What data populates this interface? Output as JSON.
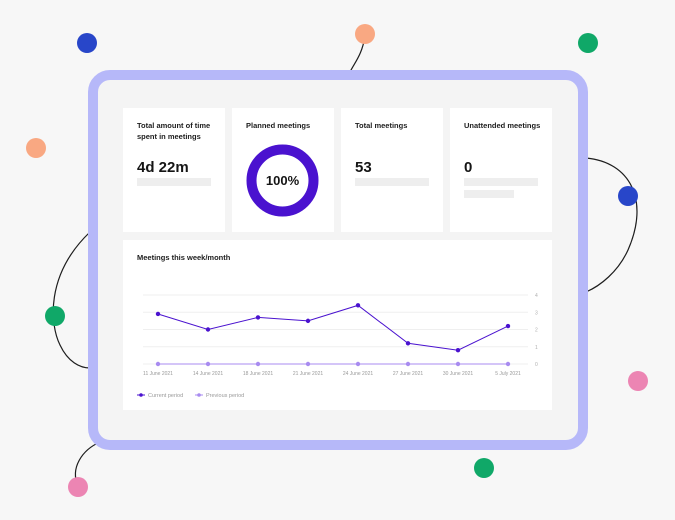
{
  "cards": {
    "total_time": {
      "title": "Total amount of time spent in meetings",
      "value": "4d 22m"
    },
    "planned": {
      "title": "Planned meetings",
      "percent_label": "100%",
      "percent": 100
    },
    "total_meetings": {
      "title": "Total meetings",
      "value": "53"
    },
    "unattended": {
      "title": "Unattended meetings",
      "value": "0"
    }
  },
  "chart": {
    "title": "Meetings this week/month"
  },
  "chart_data": {
    "type": "line",
    "categories": [
      "11 June 2021",
      "14 June 2021",
      "18 June 2021",
      "21 June 2021",
      "24 June 2021",
      "27 June 2021",
      "30 June 2021",
      "5 July 2021"
    ],
    "ylim": [
      0,
      4
    ],
    "yticks": [
      0,
      1,
      2,
      3,
      4
    ],
    "grid": true,
    "legend": "bottom-left",
    "series": [
      {
        "name": "Current period",
        "color": "#4a12cf",
        "values": [
          2.9,
          2.0,
          2.7,
          2.5,
          3.4,
          1.2,
          0.8,
          2.2
        ]
      },
      {
        "name": "Previous period",
        "color": "#a88bf0",
        "values": [
          0,
          0,
          0,
          0,
          0,
          0,
          0,
          0
        ]
      }
    ]
  },
  "colors": {
    "frame": "#b6b8f9",
    "accent": "#4a12cf",
    "prev": "#a88bf0",
    "dot_blue": "#2846c9",
    "dot_green": "#10a868",
    "dot_peach": "#f9a882",
    "dot_pink": "#ec85b3"
  }
}
